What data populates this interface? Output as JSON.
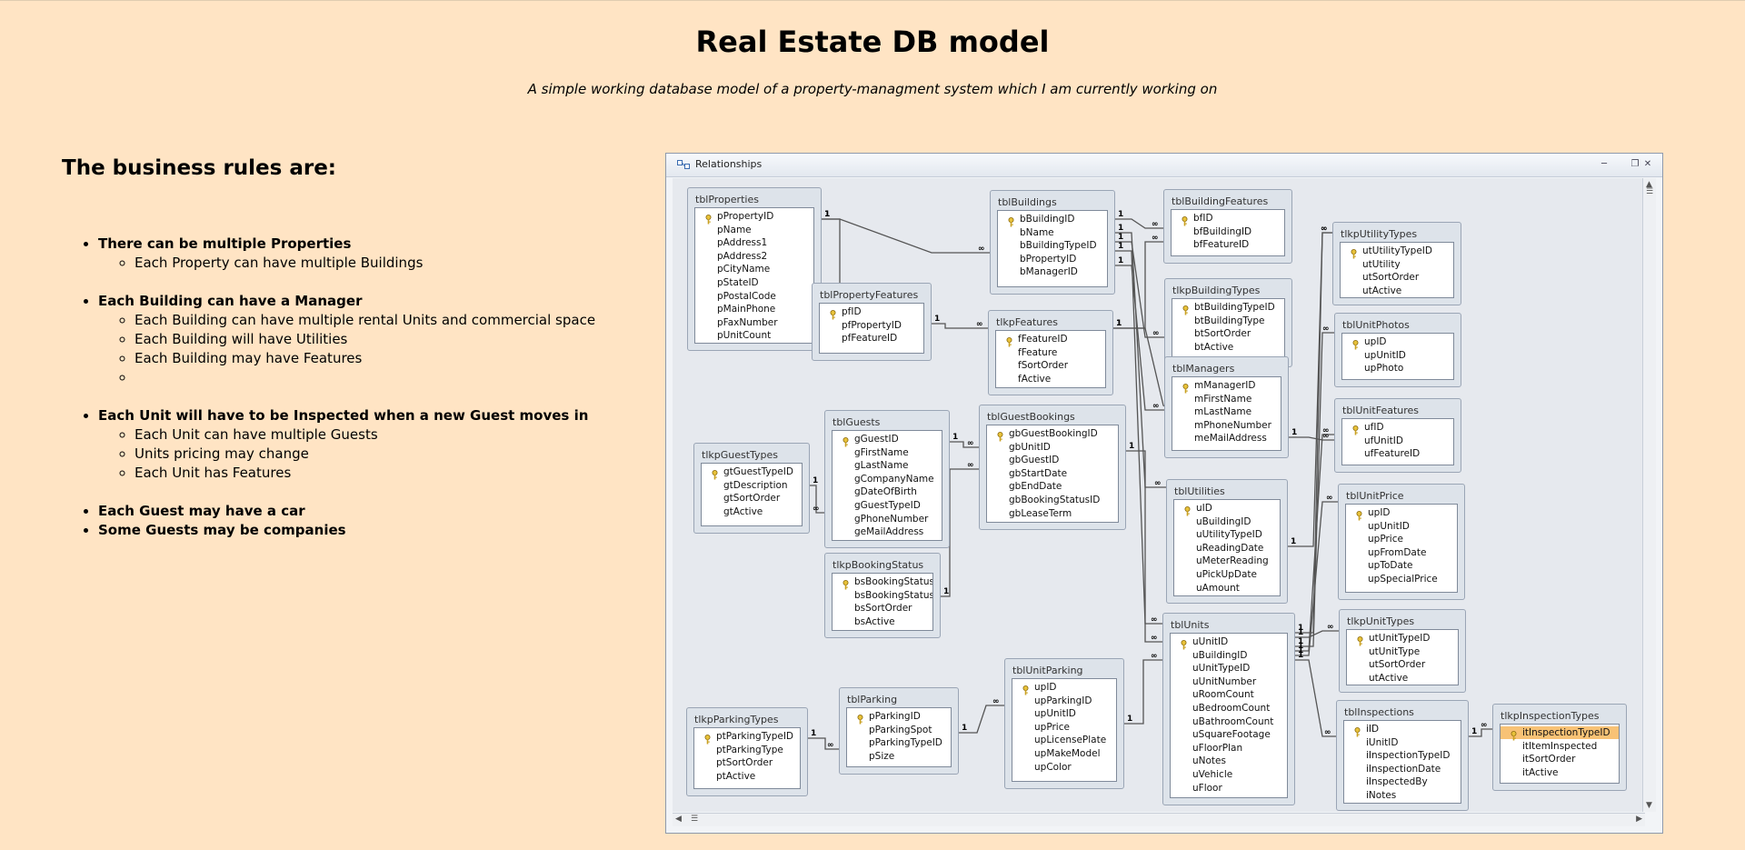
{
  "title": "Real Estate DB model",
  "subtitle": "A simple working database model of a property-managment system which I am currently working on",
  "rules_heading": "The business rules are:",
  "rules": [
    {
      "text": "There can be multiple Properties",
      "subs": [
        "Each Property can have multiple Buildings"
      ]
    },
    {
      "text": "Each Building can have a Manager",
      "subs": [
        "Each Building can have multiple rental Units and commercial space",
        "Each Building will have Utilities",
        "Each Building may have Features"
      ]
    },
    {
      "text": "Each Unit will have to be Inspected when a new Guest moves in",
      "subs": [
        "Each Unit can have multiple Guests",
        "Units pricing may change",
        "Each Unit has Features"
      ]
    },
    {
      "text": "Each Guest may have a car",
      "subs": []
    },
    {
      "text": "Some Guests may be companies",
      "subs": []
    }
  ],
  "window": {
    "title": "Relationships",
    "minimize_icon": "minimize-icon",
    "restore_icon": "restore-icon",
    "close_icon": "close-icon"
  },
  "relation_labels": {
    "one": "1",
    "many": "∞"
  },
  "tables": [
    {
      "name": "tblProperties",
      "fields": [
        "pPropertyID",
        "pName",
        "pAddress1",
        "pAddress2",
        "pCityName",
        "pStateID",
        "pPostalCode",
        "pMainPhone",
        "pFaxNumber",
        "pUnitCount"
      ]
    },
    {
      "name": "tblPropertyFeatures",
      "fields": [
        "pfID",
        "pfPropertyID",
        "pfFeatureID"
      ]
    },
    {
      "name": "tblBuildings",
      "fields": [
        "bBuildingID",
        "bName",
        "bBuildingTypeID",
        "bPropertyID",
        "bManagerID"
      ]
    },
    {
      "name": "tblBuildingFeatures",
      "fields": [
        "bfID",
        "bfBuildingID",
        "bfFeatureID"
      ]
    },
    {
      "name": "tlkpBuildingTypes",
      "fields": [
        "btBuildingTypeID",
        "btBuildingType",
        "btSortOrder",
        "btActive"
      ]
    },
    {
      "name": "tlkpFeatures",
      "fields": [
        "fFeatureID",
        "fFeature",
        "fSortOrder",
        "fActive"
      ]
    },
    {
      "name": "tblManagers",
      "fields": [
        "mManagerID",
        "mFirstName",
        "mLastName",
        "mPhoneNumber",
        "meMailAddress"
      ]
    },
    {
      "name": "tlkpUtilityTypes",
      "fields": [
        "utUtilityTypeID",
        "utUtility",
        "utSortOrder",
        "utActive"
      ]
    },
    {
      "name": "tblUnitPhotos",
      "fields": [
        "upID",
        "upUnitID",
        "upPhoto"
      ]
    },
    {
      "name": "tblUnitFeatures",
      "fields": [
        "ufID",
        "ufUnitID",
        "ufFeatureID"
      ]
    },
    {
      "name": "tblUnitPrice",
      "fields": [
        "upID",
        "upUnitID",
        "upPrice",
        "upFromDate",
        "upToDate",
        "upSpecialPrice"
      ]
    },
    {
      "name": "tlkpUnitTypes",
      "fields": [
        "utUnitTypeID",
        "utUnitType",
        "utSortOrder",
        "utActive"
      ]
    },
    {
      "name": "tblInspections",
      "fields": [
        "iID",
        "iUnitID",
        "iInspectionTypeID",
        "iInspectionDate",
        "iInspectedBy",
        "iNotes"
      ]
    },
    {
      "name": "tlkpInspectionTypes",
      "fields": [
        "itInspectionTypeID",
        "itItemInspected",
        "itSortOrder",
        "itActive"
      ]
    },
    {
      "name": "tblGuests",
      "fields": [
        "gGuestID",
        "gFirstName",
        "gLastName",
        "gCompanyName",
        "gDateOfBirth",
        "gGuestTypeID",
        "gPhoneNumber",
        "geMailAddress"
      ]
    },
    {
      "name": "tlkpGuestTypes",
      "fields": [
        "gtGuestTypeID",
        "gtDescription",
        "gtSortOrder",
        "gtActive"
      ]
    },
    {
      "name": "tblGuestBookings",
      "fields": [
        "gbGuestBookingID",
        "gbUnitID",
        "gbGuestID",
        "gbStartDate",
        "gbEndDate",
        "gbBookingStatusID",
        "gbLeaseTerm"
      ]
    },
    {
      "name": "tlkpBookingStatus",
      "fields": [
        "bsBookingStatusID",
        "bsBookingStatus",
        "bsSortOrder",
        "bsActive"
      ]
    },
    {
      "name": "tblUtilities",
      "fields": [
        "uID",
        "uBuildingID",
        "uUtilityTypeID",
        "uReadingDate",
        "uMeterReading",
        "uPickUpDate",
        "uAmount"
      ]
    },
    {
      "name": "tblUnits",
      "fields": [
        "uUnitID",
        "uBuildingID",
        "uUnitTypeID",
        "uUnitNumber",
        "uRoomCount",
        "uBedroomCount",
        "uBathroomCount",
        "uSquareFootage",
        "uFloorPlan",
        "uNotes",
        "uVehicle",
        "uFloor"
      ]
    },
    {
      "name": "tlkpParkingTypes",
      "fields": [
        "ptParkingTypeID",
        "ptParkingType",
        "ptSortOrder",
        "ptActive"
      ]
    },
    {
      "name": "tblParking",
      "fields": [
        "pParkingID",
        "pParkingSpot",
        "pParkingTypeID",
        "pSize"
      ]
    },
    {
      "name": "tblUnitParking",
      "fields": [
        "upID",
        "upParkingID",
        "upUnitID",
        "upPrice",
        "upLicensePlate",
        "upMakeModel",
        "upColor"
      ]
    }
  ]
}
